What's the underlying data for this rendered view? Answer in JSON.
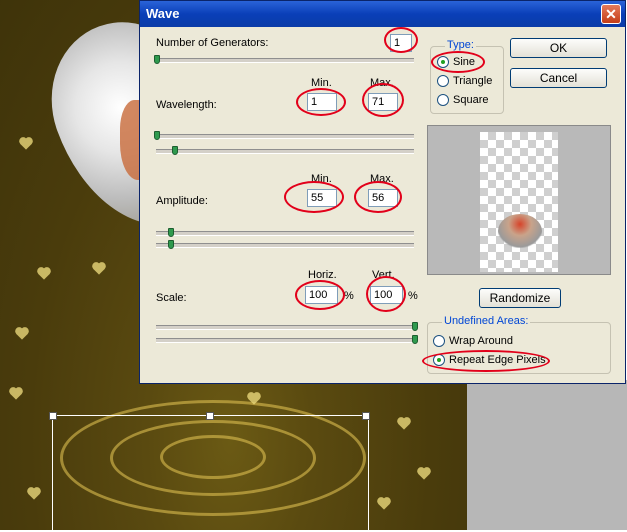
{
  "window": {
    "title": "Wave",
    "close_glyph": "✕"
  },
  "generators": {
    "label": "Number of Generators:",
    "value": "1"
  },
  "wavelength": {
    "label": "Wavelength:",
    "min_header": "Min.",
    "max_header": "Max.",
    "min": "1",
    "max": "71"
  },
  "amplitude": {
    "label": "Amplitude:",
    "min_header": "Min.",
    "max_header": "Max.",
    "min": "55",
    "max": "56"
  },
  "scale": {
    "label": "Scale:",
    "horiz_header": "Horiz.",
    "vert_header": "Vert.",
    "horiz": "100",
    "vert": "100",
    "unit": "%"
  },
  "buttons": {
    "ok": "OK",
    "cancel": "Cancel",
    "randomize": "Randomize"
  },
  "type_group": {
    "title": "Type:",
    "options": [
      "Sine",
      "Triangle",
      "Square"
    ],
    "selected": "Sine"
  },
  "undefined_areas": {
    "title": "Undefined Areas:",
    "options": [
      "Wrap Around",
      "Repeat Edge Pixels"
    ],
    "selected": "Repeat Edge Pixels"
  },
  "colors": {
    "title_bar": "#0a3fb8",
    "annotation": "#e2001a",
    "dialog_bg": "#ece9d8"
  },
  "icons": {
    "close": "close-icon"
  }
}
